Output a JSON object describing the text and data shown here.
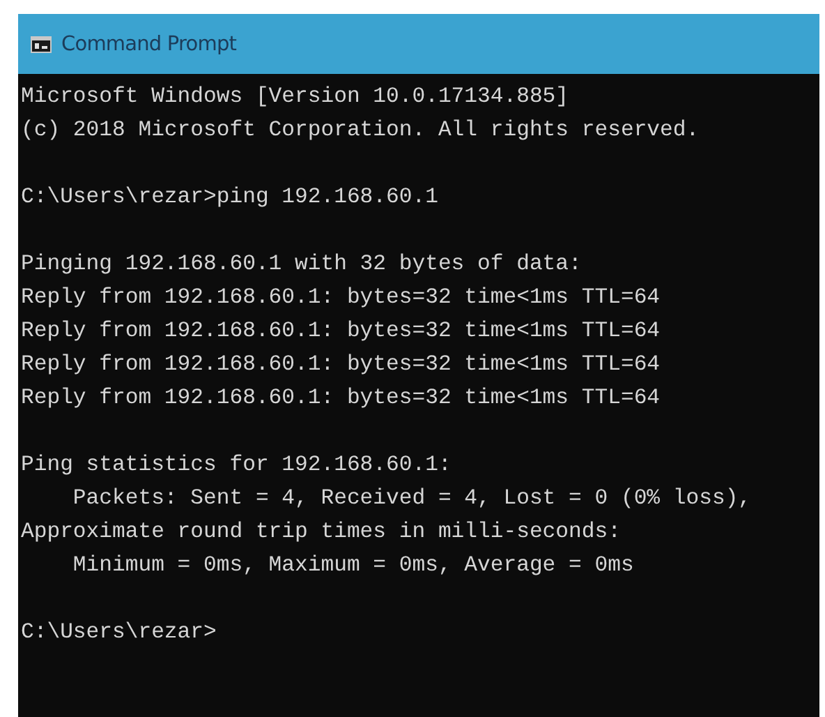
{
  "window": {
    "title": "Command Prompt"
  },
  "console": {
    "blocks": [
      {
        "lines": [
          "Microsoft Windows [Version 10.0.17134.885]",
          "(c) 2018 Microsoft Corporation. All rights reserved."
        ]
      },
      {
        "lines": [
          "C:\\Users\\rezar>ping 192.168.60.1"
        ]
      },
      {
        "lines": [
          "Pinging 192.168.60.1 with 32 bytes of data:",
          "Reply from 192.168.60.1: bytes=32 time<1ms TTL=64",
          "Reply from 192.168.60.1: bytes=32 time<1ms TTL=64",
          "Reply from 192.168.60.1: bytes=32 time<1ms TTL=64",
          "Reply from 192.168.60.1: bytes=32 time<1ms TTL=64"
        ]
      },
      {
        "lines": [
          "Ping statistics for 192.168.60.1:",
          "    Packets: Sent = 4, Received = 4, Lost = 0 (0% loss),",
          "Approximate round trip times in milli-seconds:",
          "    Minimum = 0ms, Maximum = 0ms, Average = 0ms"
        ]
      },
      {
        "lines": [
          "C:\\Users\\rezar>"
        ]
      }
    ]
  }
}
